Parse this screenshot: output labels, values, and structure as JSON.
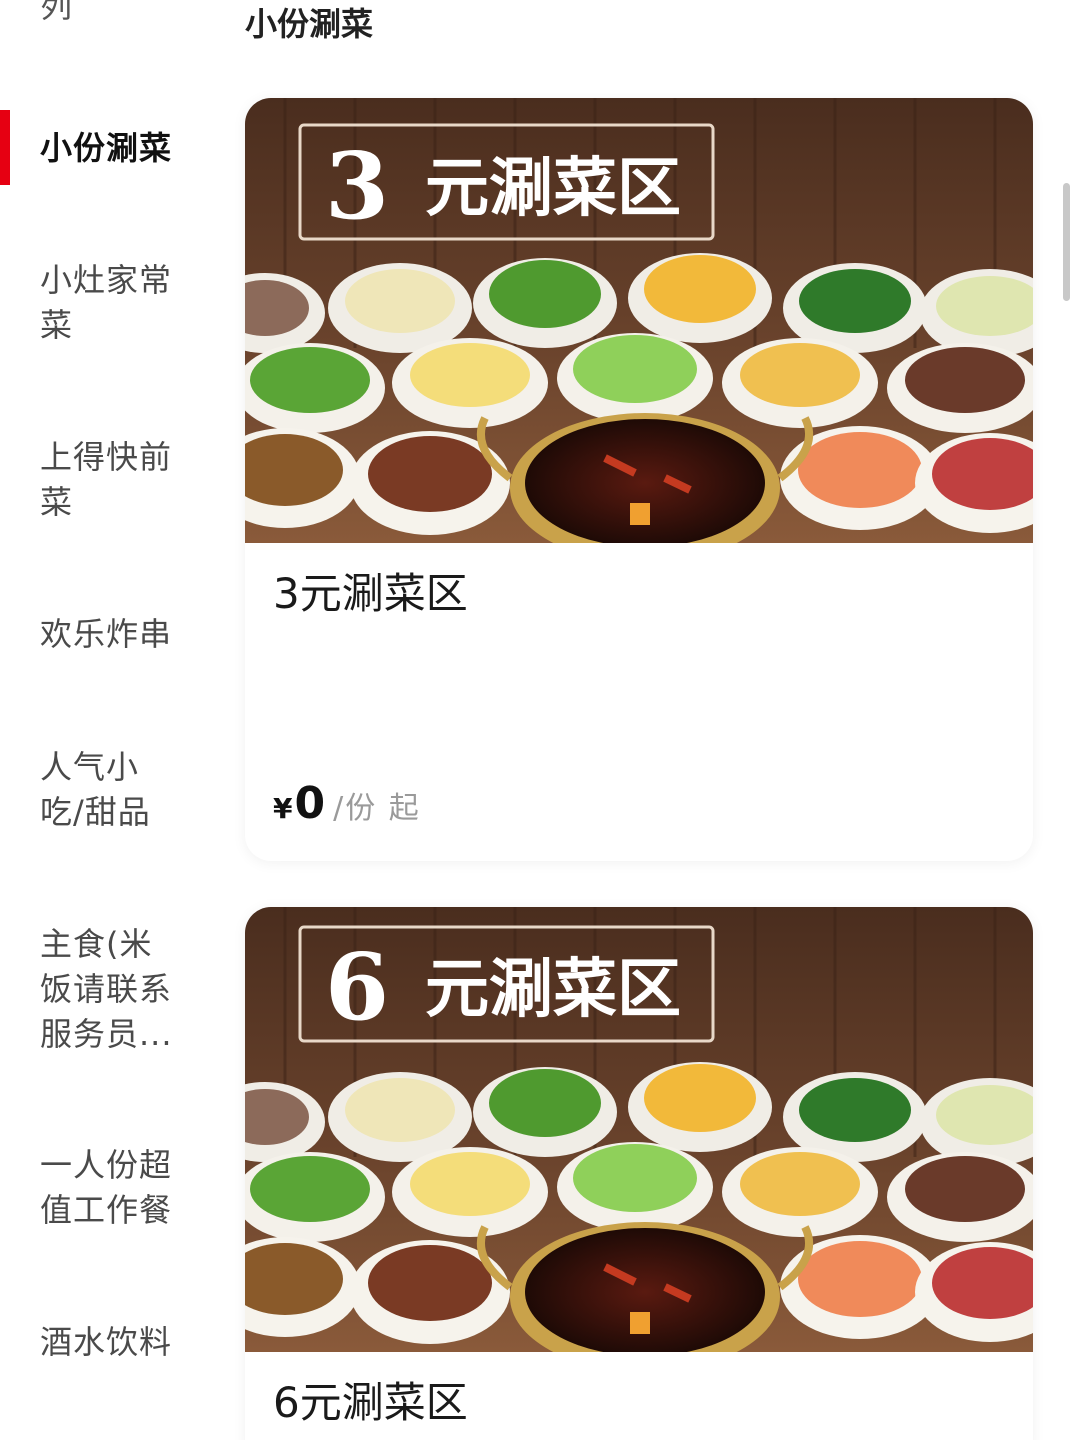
{
  "sidebar": {
    "cut_label": "列",
    "items": [
      {
        "label": "小份涮菜",
        "active": true
      },
      {
        "label": "小灶家常菜"
      },
      {
        "label": "上得快前菜"
      },
      {
        "label": "欢乐炸串"
      },
      {
        "label": "人气小吃/甜品"
      },
      {
        "label": "主食(米饭请联系服务员..."
      },
      {
        "label": "一人份超值工作餐"
      },
      {
        "label": "酒水饮料"
      }
    ],
    "accent_color": "#e60012"
  },
  "section": {
    "title": "小份涮菜"
  },
  "products": [
    {
      "banner_number": "3",
      "banner_text": "元涮菜区",
      "name": "3元涮菜区",
      "price_symbol": "¥",
      "price": "0",
      "price_unit": "/份 起"
    },
    {
      "banner_number": "6",
      "banner_text": "元涮菜区",
      "name": "6元涮菜区"
    }
  ]
}
